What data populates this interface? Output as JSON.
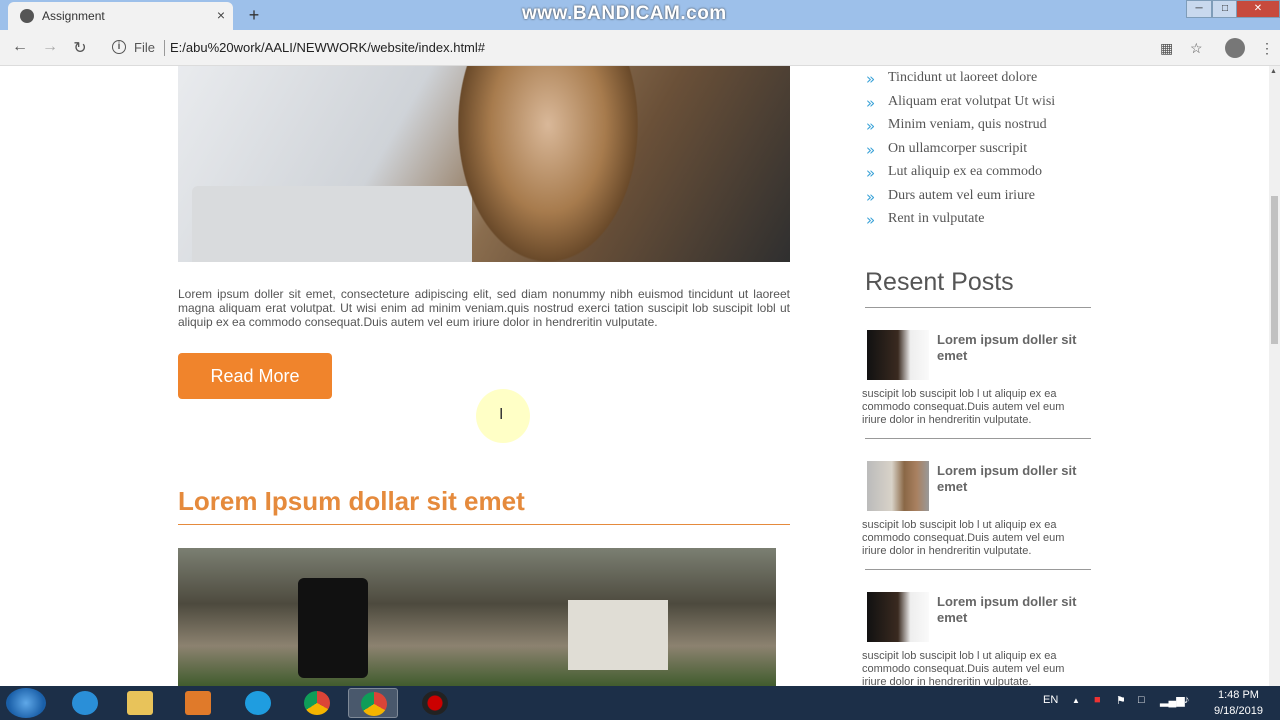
{
  "browser": {
    "tab_title": "Assignment",
    "tab_close": "×",
    "new_tab": "+",
    "watermark": "www.BANDICAM.com",
    "omnibox_scheme": "File",
    "omnibox_url": "E:/abu%20work/AALI/NEWWORK/website/index.html#"
  },
  "main": {
    "paragraph": "Lorem ipsum doller sit emet, consecteture adipiscing elit, sed diam nonummy nibh euismod tincidunt ut laoreet magna aliquam erat volutpat. Ut wisi enim ad minim veniam.quis nostrud exerci tation suscipit lob suscipit lobl ut aliquip ex ea commodo consequat.Duis autem vel eum iriure dolor in hendreritin vulputate.",
    "read_more": "Read More",
    "heading": "Lorem Ipsum dollar sit emet"
  },
  "sidebar": {
    "list": [
      "Tincidunt ut laoreet dolore",
      "Aliquam erat volutpat Ut wisi",
      "Minim veniam, quis nostrud",
      "On ullamcorper suscripit",
      "Lut aliquip ex ea commodo",
      "Durs autem vel eum iriure",
      "Rent in vulputate"
    ],
    "chevron": "»",
    "recent_posts_title": "Resent Posts",
    "posts": [
      {
        "title": "Lorem ipsum doller sit emet",
        "desc": "suscipit lob suscipit lob l ut aliquip ex ea commodo consequat.Duis autem vel eum iriure dolor in hendreritin vulputate."
      },
      {
        "title": "Lorem ipsum doller sit emet",
        "desc": "suscipit lob suscipit lob l ut aliquip ex ea commodo consequat.Duis autem vel eum iriure dolor in hendreritin vulputate."
      },
      {
        "title": "Lorem ipsum doller sit emet",
        "desc": "suscipit lob suscipit lob l ut aliquip ex ea commodo consequat.Duis autem vel eum iriure dolor in hendreritin vulputate."
      }
    ]
  },
  "taskbar": {
    "lang": "EN",
    "time": "1:48 PM",
    "date": "9/18/2019"
  }
}
